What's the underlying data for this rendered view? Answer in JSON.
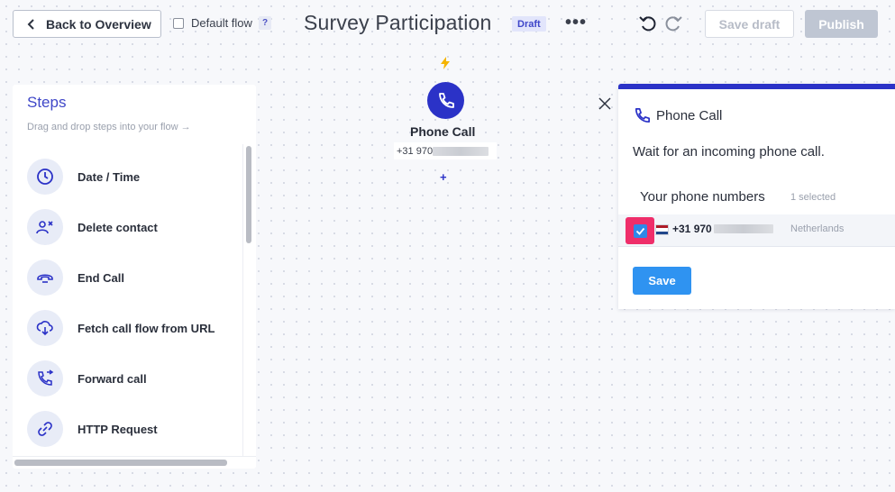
{
  "header": {
    "back_label": "Back to Overview",
    "default_flow_label": "Default flow",
    "help_label": "?",
    "title": "Survey Participation",
    "status_badge": "Draft",
    "more_label": "•••",
    "save_draft_label": "Save draft",
    "publish_label": "Publish"
  },
  "steps": {
    "title": "Steps",
    "hint": "Drag and drop steps into your flow →",
    "items": [
      {
        "label": "Date / Time",
        "icon": "clock-icon"
      },
      {
        "label": "Delete contact",
        "icon": "remove-contact-icon"
      },
      {
        "label": "End Call",
        "icon": "hangup-icon"
      },
      {
        "label": "Fetch call flow from URL",
        "icon": "cloud-download-icon"
      },
      {
        "label": "Forward call",
        "icon": "forward-call-icon"
      },
      {
        "label": "HTTP Request",
        "icon": "link-icon"
      }
    ]
  },
  "node": {
    "title": "Phone Call",
    "number_prefix": "+31 970",
    "add_label": "+"
  },
  "panel": {
    "title": "Phone Call",
    "description": "Wait for an incoming phone call.",
    "numbers_label": "Your phone numbers",
    "selected_count": "1 selected",
    "phone": {
      "number_prefix": "+31 970",
      "country": "Netherlands",
      "checked": true
    },
    "save_label": "Save"
  },
  "colors": {
    "accent": "#2b32c7",
    "highlight": "#ef2e6a",
    "checkbox": "#2e88e8",
    "save_button": "#2f93f1"
  }
}
